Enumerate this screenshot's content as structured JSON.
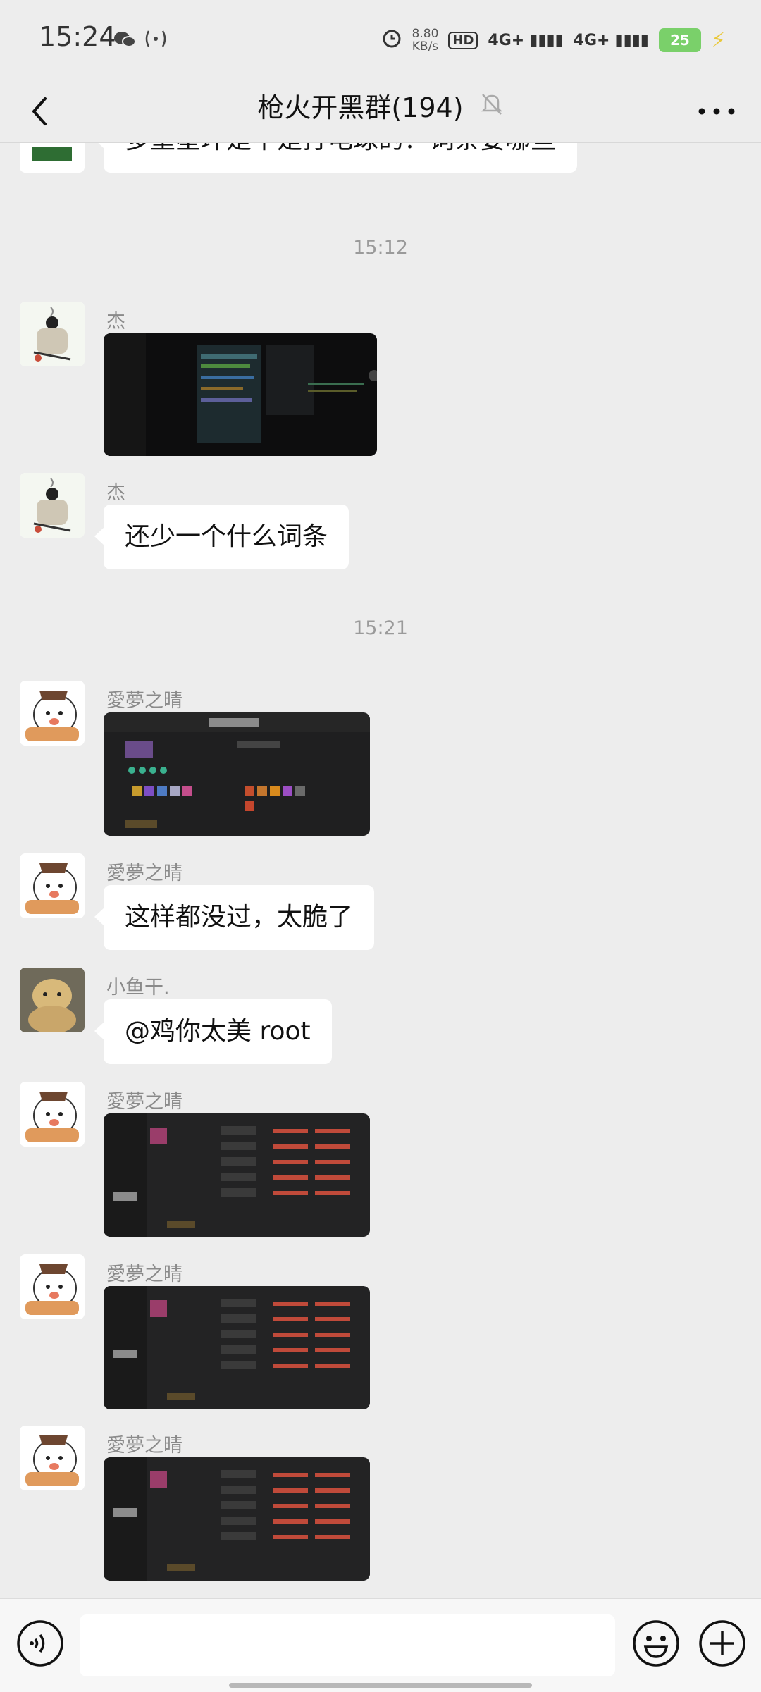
{
  "status_bar": {
    "time": "15:24",
    "net_speed": "8.80",
    "net_speed_unit": "KB/s",
    "hd_label": "HD",
    "net_type_1": "4G+",
    "net_type_2": "4G+",
    "battery": "25"
  },
  "header": {
    "title": "枪火开黑群(194)"
  },
  "messages": [
    {
      "sender": "",
      "text": "多重星环是不是打电球的？词条要哪些"
    },
    {
      "timestamp": "15:12"
    },
    {
      "sender": "杰",
      "type": "image"
    },
    {
      "sender": "杰",
      "text": "还少一个什么词条"
    },
    {
      "timestamp": "15:21"
    },
    {
      "sender": "愛夢之晴",
      "type": "image"
    },
    {
      "sender": "愛夢之晴",
      "text": "这样都没过，太脆了"
    },
    {
      "sender": "小鱼干.",
      "text": "@鸡你太美  root"
    },
    {
      "sender": "愛夢之晴",
      "type": "image"
    },
    {
      "sender": "愛夢之晴",
      "type": "image"
    },
    {
      "sender": "愛夢之晴",
      "type": "image"
    }
  ],
  "icons": {
    "back": "chevron-left-icon",
    "mute": "bell-off-icon",
    "more": "more-dots-icon",
    "voice": "voice-icon",
    "emoji": "emoji-icon",
    "plus": "plus-icon"
  },
  "colors": {
    "background": "#ededed",
    "bubble": "#ffffff",
    "sender": "#8a8a8a",
    "battery": "#7ad06a"
  }
}
